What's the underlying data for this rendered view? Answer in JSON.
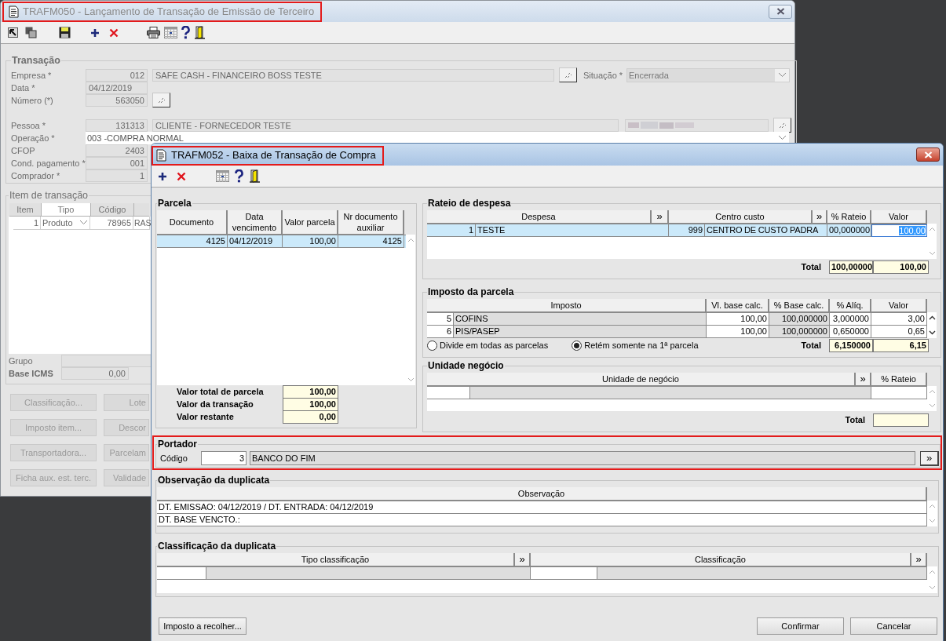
{
  "background_window": {
    "title": "TRAFM050 - Lançamento de Transação de Emissão de Terceiro",
    "transaction": {
      "legend": "Transação",
      "empresa": {
        "label": "Empresa *",
        "code": "012",
        "name": "SAFE CASH - FINANCEIRO BOSS TESTE"
      },
      "situacao": {
        "label": "Situação *",
        "value": "Encerrada"
      },
      "data": {
        "label": "Data *",
        "value": "04/12/2019"
      },
      "numero": {
        "label": "Número (*)",
        "value": "563050"
      },
      "pessoa": {
        "label": "Pessoa *",
        "code": "131313",
        "name": "CLIENTE - FORNECEDOR TESTE"
      },
      "operacao": {
        "label": "Operação *",
        "value": "003 -COMPRA NORMAL"
      },
      "cfop": {
        "label": "CFOP",
        "value": "2403"
      },
      "cond_pagamento": {
        "label": "Cond. pagamento *",
        "value": "001"
      },
      "comprador": {
        "label": "Comprador *",
        "value": "1"
      }
    },
    "items": {
      "legend": "Item de transação",
      "columns": [
        "Item",
        "Tipo",
        "Código"
      ],
      "row": [
        "1",
        "Produto",
        "78965",
        "RAS"
      ],
      "grupo_label": "Grupo",
      "base_icms_label": "Base ICMS",
      "base_icms_value": "0,00"
    },
    "buttons": [
      {
        "label": "Classificação...",
        "disabled": true
      },
      {
        "label": "Lote",
        "disabled": true
      },
      {
        "label": "Imposto item...",
        "disabled": true
      },
      {
        "label": "Descor",
        "disabled": true
      },
      {
        "label": "Transportadora...",
        "disabled": true
      },
      {
        "label": "Parcelam",
        "disabled": true
      },
      {
        "label": "Ficha aux. est. terc.",
        "disabled": true
      },
      {
        "label": "Validade",
        "disabled": true
      }
    ]
  },
  "dialog": {
    "title": "TRAFM052 - Baixa de Transação de Compra",
    "parcela": {
      "legend": "Parcela",
      "columns": [
        "Documento",
        "Data vencimento",
        "Valor parcela",
        "Nr documento auxiliar"
      ],
      "rows": [
        {
          "cells": [
            "4125",
            "04/12/2019",
            "100,00",
            "4125"
          ],
          "selected": true
        }
      ],
      "totals": [
        {
          "label": "Valor total de parcela",
          "value": "100,00"
        },
        {
          "label": "Valor da transação",
          "value": "100,00"
        },
        {
          "label": "Valor restante",
          "value": "0,00"
        }
      ]
    },
    "rateio": {
      "legend": "Rateio de despesa",
      "columns": [
        {
          "label": "Despesa",
          "lookup": "»"
        },
        {
          "label": "Centro custo",
          "lookup": "»"
        },
        {
          "label": "% Rateio"
        },
        {
          "label": "Valor"
        }
      ],
      "rows": [
        {
          "despesa": {
            "code": "1",
            "name": "TESTE"
          },
          "centro_custo": {
            "code": "999",
            "name": "CENTRO DE CUSTO PADRA"
          },
          "rateio": "00,000000",
          "valor": "100,00",
          "selected": true
        }
      ],
      "total_label": "Total",
      "totals": [
        "100,00000",
        "100,00"
      ]
    },
    "imposto": {
      "legend": "Imposto da parcela",
      "columns": [
        "Imposto",
        "Vl. base calc.",
        "% Base calc.",
        "% Alíq.",
        "Valor"
      ],
      "rows": [
        {
          "imposto": {
            "code": "5",
            "name": "COFINS"
          },
          "base_calc": "100,00",
          "base_pct": "100,000000",
          "aliq": "3,000000",
          "valor": "3,00"
        },
        {
          "imposto": {
            "code": "6",
            "name": "PIS/PASEP"
          },
          "base_calc": "100,00",
          "base_pct": "100,000000",
          "aliq": "0,650000",
          "valor": "0,65"
        }
      ],
      "options": [
        {
          "label": "Divide em todas as parcelas",
          "selected": false
        },
        {
          "label": "Retém somente na 1ª parcela",
          "selected": true
        }
      ],
      "total_label": "Total",
      "totals": [
        "6,150000",
        "6,15"
      ]
    },
    "unidade": {
      "legend": "Unidade negócio",
      "columns": [
        {
          "label": "Unidade de negócio",
          "lookup": "»"
        },
        {
          "label": "% Rateio"
        }
      ],
      "total_label": "Total"
    },
    "portador": {
      "legend": "Portador",
      "label": "Código",
      "code": "3",
      "name": "BANCO DO FIM",
      "lookup": "»"
    },
    "observacao": {
      "legend": "Observação da duplicata",
      "column": "Observação",
      "rows": [
        "DT. EMISSAO: 04/12/2019 / DT. ENTRADA: 04/12/2019",
        "DT. BASE VENCTO.:"
      ]
    },
    "classificacao": {
      "legend": "Classificação da duplicata",
      "columns": [
        {
          "label": "Tipo classificação",
          "lookup": "»"
        },
        {
          "label": "Classificação",
          "lookup": "»"
        }
      ]
    },
    "left_buttons": [
      "Imposto a recolher..."
    ],
    "right_buttons": [
      "Confirmar",
      "Cancelar"
    ]
  }
}
